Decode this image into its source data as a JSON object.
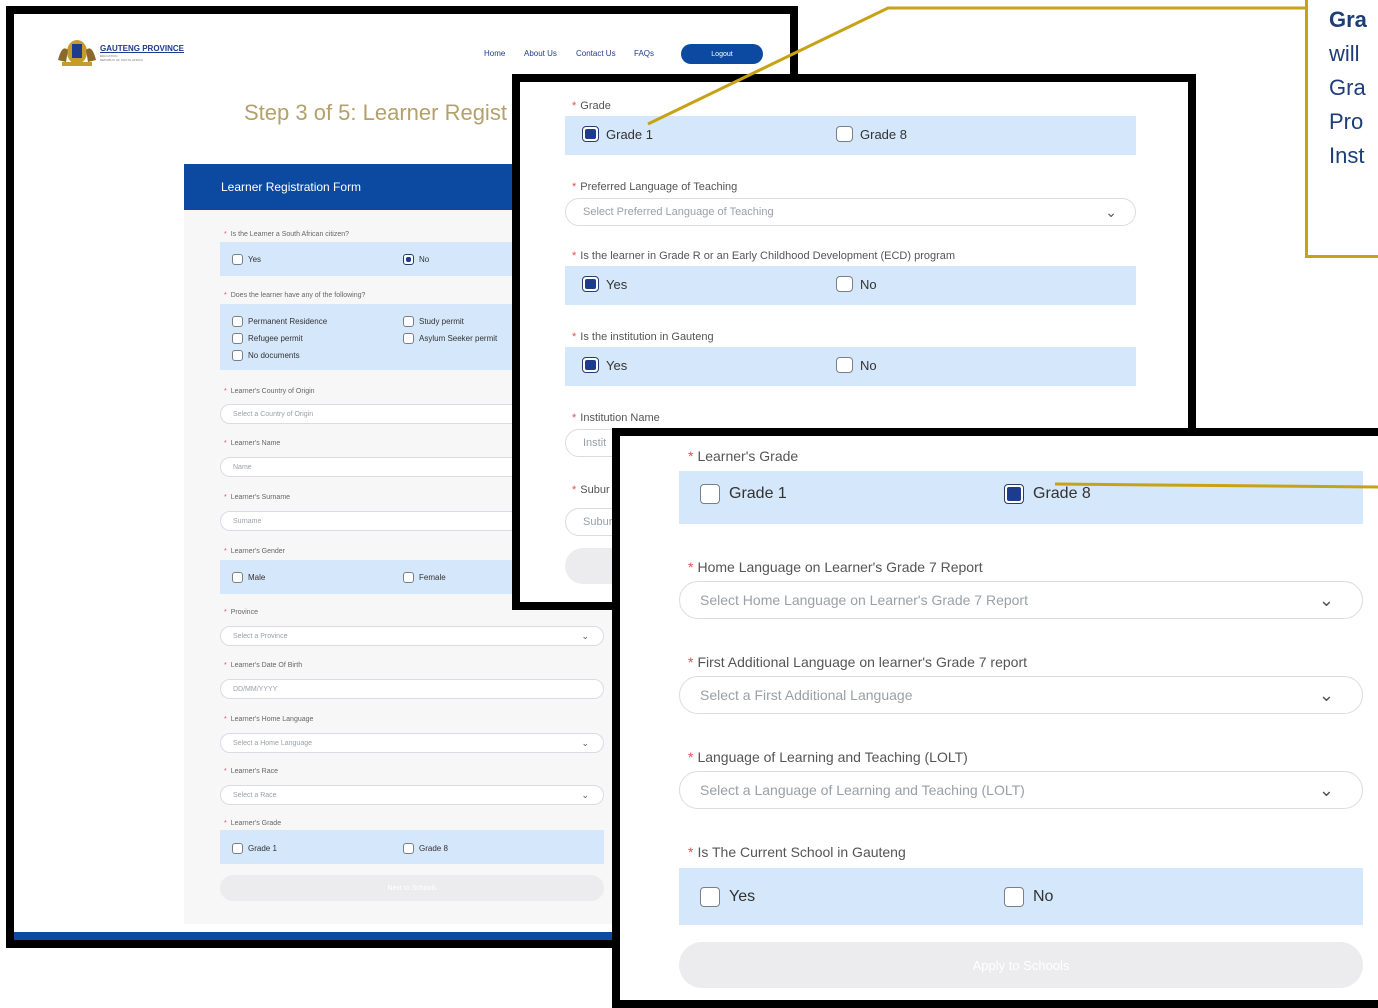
{
  "colors": {
    "accent": "#0b4aa0",
    "option_bg": "#d5e7fa",
    "callout_border": "#c8a215",
    "step_title": "#b4a06a"
  },
  "back": {
    "logo_name": "GAUTENG PROVINCE",
    "logo_sub1": "EDUCATION",
    "logo_sub2": "REPUBLIC OF SOUTH AFRICA",
    "nav": {
      "home": "Home",
      "about": "About Us",
      "contact": "Contact Us",
      "faqs": "FAQs",
      "logout": "Logout"
    },
    "step_title": "Step 3 of 5: Learner Regist",
    "form_title": "Learner Registration Form",
    "q_citizen": "Is the Learner a South African citizen?",
    "yes": "Yes",
    "no": "No",
    "q_docs": "Does the learner have any of the following?",
    "docs": {
      "perm": "Permanent Residence",
      "study": "Study permit",
      "refugee": "Refugee permit",
      "asylum": "Asylum Seeker permit",
      "none": "No documents"
    },
    "q_country": "Learner's Country of Origin",
    "ph_country": "Select a Country of Origin",
    "q_name": "Learner's Name",
    "ph_name": "Name",
    "q_surname": "Learner's Surname",
    "ph_surname": "Surname",
    "q_gender": "Learner's Gender",
    "male": "Male",
    "female": "Female",
    "q_province": "Province",
    "ph_province": "Select a Province",
    "q_dob": "Learner's Date Of Birth",
    "ph_dob": "DD/MM/YYYY",
    "q_homelang": "Learner's Home Language",
    "ph_homelang": "Select a Home Language",
    "q_race": "Learner's Race",
    "ph_race": "Select a Race",
    "q_grade": "Learner's Grade",
    "grade1": "Grade 1",
    "grade8": "Grade 8",
    "next_btn": "Next to Schools"
  },
  "mid": {
    "q_grade": "Grade",
    "grade1": "Grade 1",
    "grade8": "Grade 8",
    "q_lang": "Preferred Language of Teaching",
    "ph_lang": "Select Preferred Language of Teaching",
    "q_ecd": "Is the learner in Grade R or an Early Childhood Development (ECD) program",
    "yes": "Yes",
    "no": "No",
    "q_inst_gauteng": "Is the institution in Gauteng",
    "q_inst_name": "Institution Name",
    "ph_inst_name": "Instit",
    "q_suburb": "Subur",
    "ph_suburb": "Subur"
  },
  "front": {
    "q_grade": "Learner's Grade",
    "grade1": "Grade 1",
    "grade8": "Grade 8",
    "q_home": "Home Language on Learner's Grade 7 Report",
    "ph_home": "Select Home Language on Learner's Grade 7 Report",
    "q_fal": "First Additional Language on learner's Grade 7 report",
    "ph_fal": "Select a First Additional Language",
    "q_lolt": "Language of Learning and Teaching (LOLT)",
    "ph_lolt": "Select a Language of Learning and Teaching (LOLT)",
    "q_school": "Is The Current School in Gauteng",
    "yes": "Yes",
    "no": "No",
    "apply_btn": "Apply to Schools"
  },
  "callout": {
    "line1": "Gra",
    "line2": "will",
    "line3": "Gra",
    "line4": "Pro",
    "line5": "Inst"
  }
}
